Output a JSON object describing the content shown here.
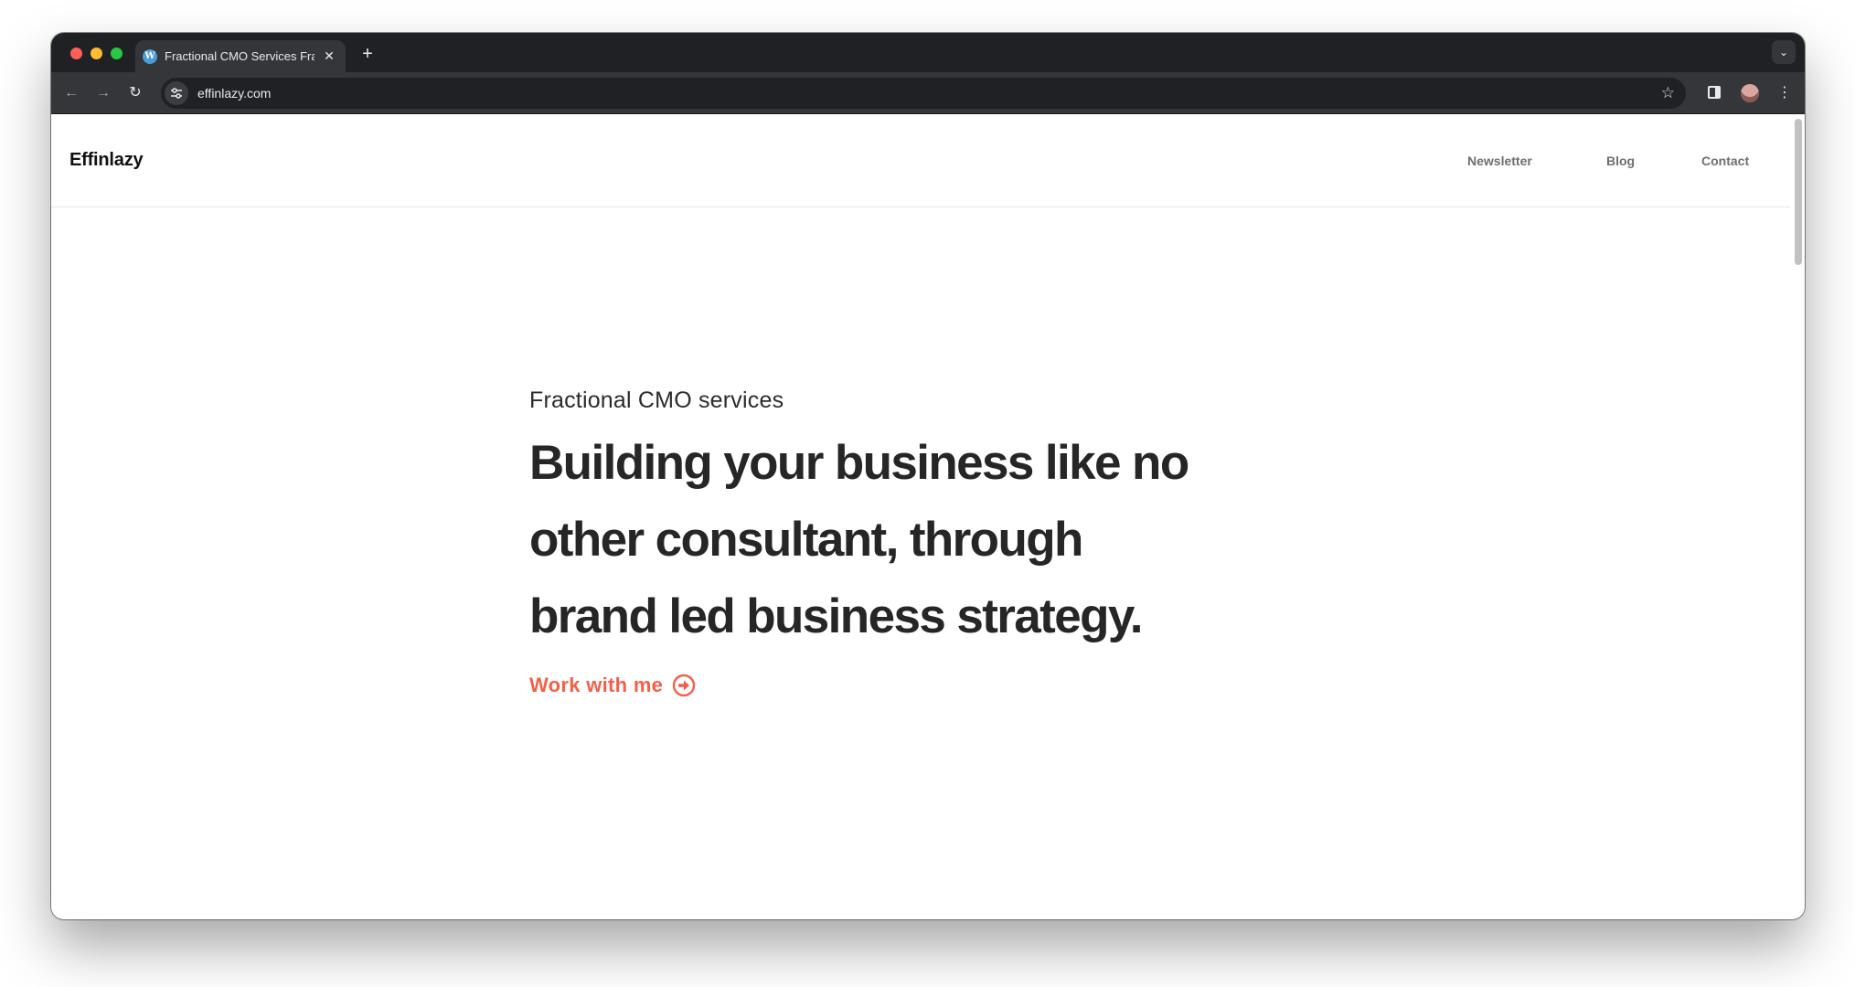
{
  "browser": {
    "tab_title": "Fractional CMO Services Frac",
    "tab_favicon": "wordpress-icon",
    "url": "effinlazy.com"
  },
  "site": {
    "logo": "Effinlazy",
    "nav": [
      "Newsletter",
      "Blog",
      "Contact"
    ]
  },
  "hero": {
    "eyebrow": "Fractional CMO services",
    "headline_lines": [
      "Building your business like no",
      "other consultant, through",
      "brand led business strategy."
    ],
    "cta": "Work with me"
  },
  "colors": {
    "accent": "#f2604a",
    "headline": "#262626",
    "chrome_dark": "#202124",
    "chrome_toolbar": "#35363a"
  }
}
